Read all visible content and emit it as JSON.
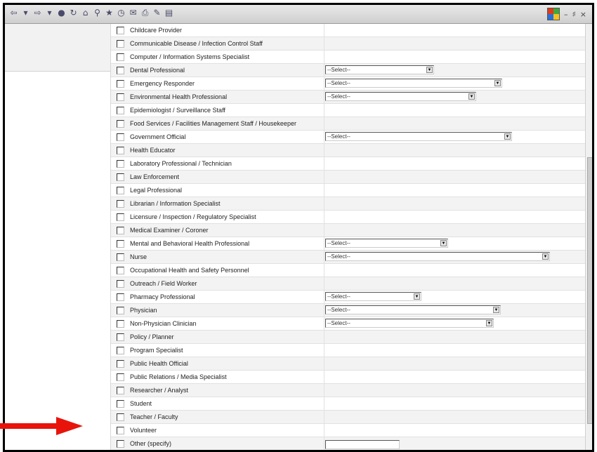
{
  "toolbar": {
    "icons": [
      "back-icon",
      "dropdown-icon",
      "forward-icon",
      "dropdown-icon",
      "stop-icon",
      "refresh-icon",
      "home-icon",
      "search-icon",
      "favorites-icon",
      "history-icon",
      "mail-icon",
      "print-icon",
      "edit-icon",
      "discuss-icon"
    ]
  },
  "window_controls": {
    "minimize": "–",
    "restore": "♯",
    "close": "×"
  },
  "select_placeholder": "--Select--",
  "rows": [
    {
      "label": "Childcare Provider",
      "control": "none"
    },
    {
      "label": "Communicable Disease / Infection Control Staff",
      "control": "none"
    },
    {
      "label": "Computer / Information Systems Specialist",
      "control": "none"
    },
    {
      "label": "Dental Professional",
      "control": "select",
      "value": "--Select--"
    },
    {
      "label": "Emergency Responder",
      "control": "select",
      "value": "--Select--"
    },
    {
      "label": "Environmental Health Professional",
      "control": "select",
      "value": "--Select--"
    },
    {
      "label": "Epidemiologist / Surveillance Staff",
      "control": "none"
    },
    {
      "label": "Food Services / Facilities Management Staff / Housekeeper",
      "control": "none"
    },
    {
      "label": "Government Official",
      "control": "select",
      "value": "--Select--"
    },
    {
      "label": "Health Educator",
      "control": "none"
    },
    {
      "label": "Laboratory Professional / Technician",
      "control": "none"
    },
    {
      "label": "Law Enforcement",
      "control": "none"
    },
    {
      "label": "Legal Professional",
      "control": "none"
    },
    {
      "label": "Librarian / Information Specialist",
      "control": "none"
    },
    {
      "label": "Licensure / Inspection / Regulatory Specialist",
      "control": "none"
    },
    {
      "label": "Medical Examiner / Coroner",
      "control": "none"
    },
    {
      "label": "Mental and Behavioral Health Professional",
      "control": "select",
      "value": "--Select--"
    },
    {
      "label": "Nurse",
      "control": "select",
      "value": "--Select--"
    },
    {
      "label": "Occupational Health and Safety Personnel",
      "control": "none"
    },
    {
      "label": "Outreach / Field Worker",
      "control": "none"
    },
    {
      "label": "Pharmacy Professional",
      "control": "select",
      "value": "--Select--"
    },
    {
      "label": "Physician",
      "control": "select",
      "value": "--Select--"
    },
    {
      "label": "Non-Physician Clinician",
      "control": "select",
      "value": "--Select--"
    },
    {
      "label": "Policy / Planner",
      "control": "none"
    },
    {
      "label": "Program Specialist",
      "control": "none"
    },
    {
      "label": "Public Health Official",
      "control": "none"
    },
    {
      "label": "Public Relations / Media Specialist",
      "control": "none"
    },
    {
      "label": "Researcher / Analyst",
      "control": "none"
    },
    {
      "label": "Student",
      "control": "none"
    },
    {
      "label": "Teacher / Faculty",
      "control": "none"
    },
    {
      "label": "Volunteer",
      "control": "none"
    },
    {
      "label": "Other (specify)",
      "control": "text"
    }
  ],
  "colors": {
    "arrow": "#e8140c",
    "frame": "#000000"
  }
}
